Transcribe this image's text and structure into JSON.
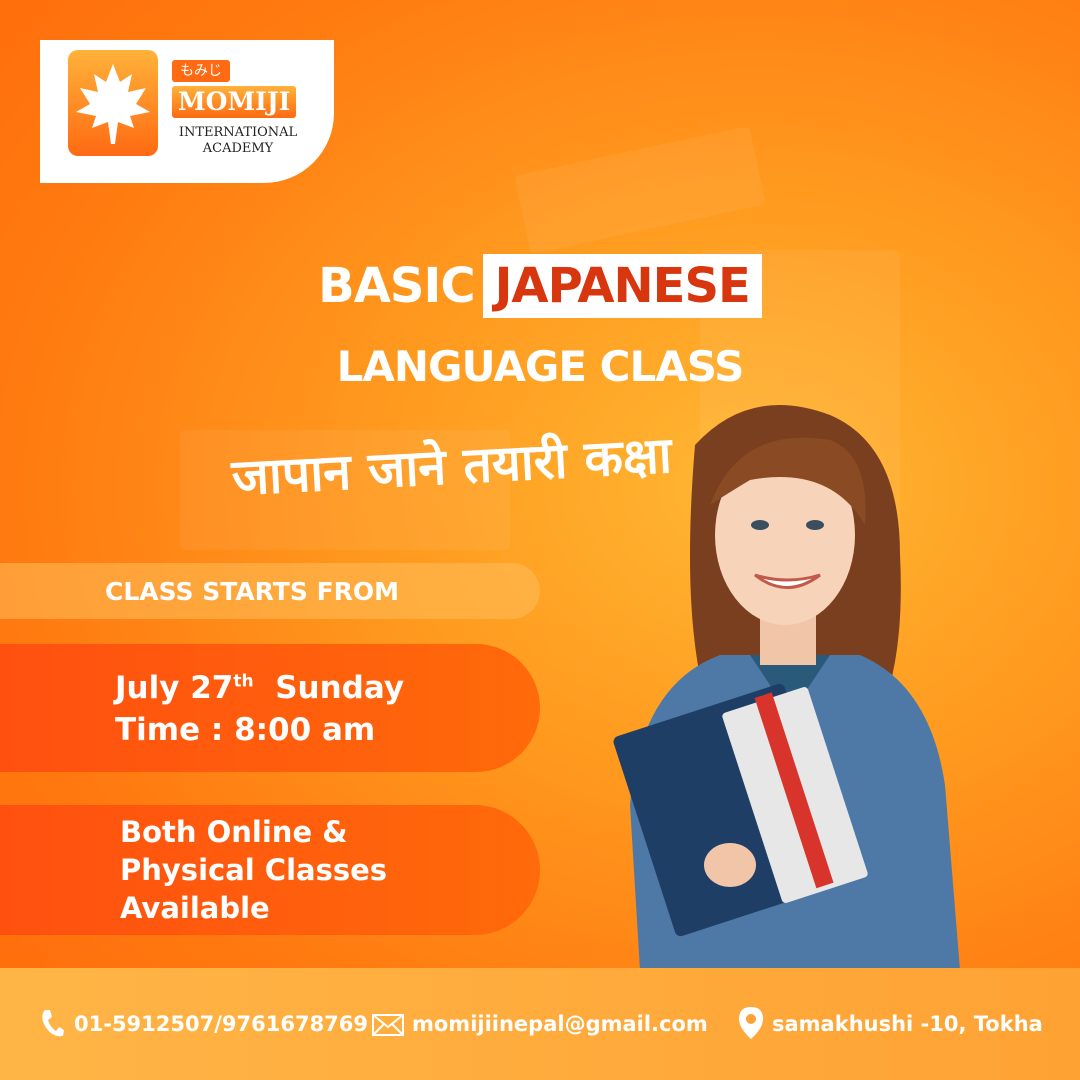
{
  "brand": {
    "japanese_text": "もみじ",
    "name": "MOMIJI",
    "subtitle_line1": "INTERNATIONAL",
    "subtitle_line2": "ACADEMY"
  },
  "headline": {
    "word1": "BASIC",
    "word2_highlight": "JAPANESE",
    "line2": "LANGUAGE CLASS"
  },
  "nepali_tagline": "जापान जाने तयारी कक्षा",
  "schedule": {
    "label": "CLASS STARTS FROM",
    "date_month": "July 27",
    "date_suffix": "th",
    "date_day": "Sunday",
    "time": "Time :  8:00 am"
  },
  "availability": {
    "line1": "Both Online &",
    "line2": "Physical Classes",
    "line3": "Available"
  },
  "footer": {
    "phone": "01-5912507/9761678769",
    "email": "momijiinepal@gmail.com",
    "address": "samakhushi -10, Tokha"
  },
  "colors": {
    "accent_red": "#d8360e",
    "orange": "#ff7a10",
    "white": "#ffffff"
  },
  "icons": [
    "maple-leaf-icon",
    "phone-icon",
    "mail-icon",
    "location-pin-icon"
  ]
}
